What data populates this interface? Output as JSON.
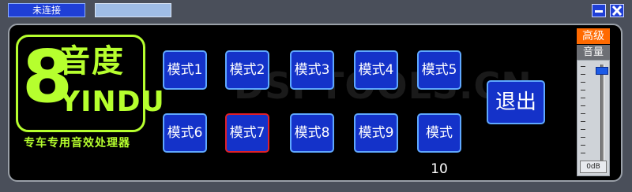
{
  "titlebar": {
    "connection_status": "未连接",
    "field_value": ""
  },
  "window_controls": {
    "minimize_icon": "minimize-icon",
    "close_icon": "close-icon"
  },
  "logo": {
    "digit": "8",
    "brand_cn": "音度",
    "brand_en": "YINDU",
    "tagline": "专车专用音效处理器"
  },
  "watermark": "DSPTOOLS.CN",
  "modes": [
    {
      "label": "模式1",
      "active": false
    },
    {
      "label": "模式2",
      "active": false
    },
    {
      "label": "模式3",
      "active": false
    },
    {
      "label": "模式4",
      "active": false
    },
    {
      "label": "模式5",
      "active": false
    },
    {
      "label": "模式6",
      "active": false
    },
    {
      "label": "模式7",
      "active": true
    },
    {
      "label": "模式8",
      "active": false
    },
    {
      "label": "模式9",
      "active": false
    },
    {
      "label": "模式10",
      "active": false
    }
  ],
  "exit_label": "退出",
  "volume": {
    "advanced_label": "高级",
    "label": "音量",
    "value_text": "0dB",
    "level_fraction": 0.97
  },
  "colors": {
    "accent_blue": "#1432c9",
    "logo_green": "#b6ff2e",
    "active_border": "#e0202a",
    "advanced_orange": "#ff6a00"
  }
}
